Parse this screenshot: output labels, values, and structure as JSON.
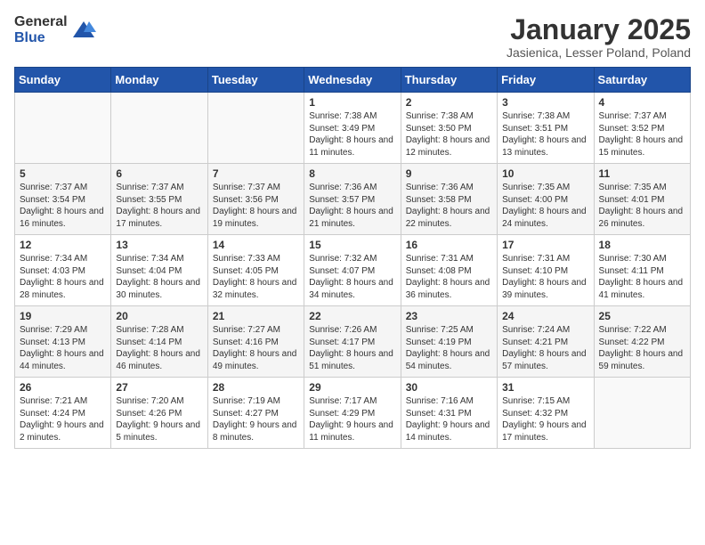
{
  "header": {
    "logo_general": "General",
    "logo_blue": "Blue",
    "month_title": "January 2025",
    "location": "Jasienica, Lesser Poland, Poland"
  },
  "weekdays": [
    "Sunday",
    "Monday",
    "Tuesday",
    "Wednesday",
    "Thursday",
    "Friday",
    "Saturday"
  ],
  "weeks": [
    [
      {
        "day": "",
        "info": ""
      },
      {
        "day": "",
        "info": ""
      },
      {
        "day": "",
        "info": ""
      },
      {
        "day": "1",
        "info": "Sunrise: 7:38 AM\nSunset: 3:49 PM\nDaylight: 8 hours and 11 minutes."
      },
      {
        "day": "2",
        "info": "Sunrise: 7:38 AM\nSunset: 3:50 PM\nDaylight: 8 hours and 12 minutes."
      },
      {
        "day": "3",
        "info": "Sunrise: 7:38 AM\nSunset: 3:51 PM\nDaylight: 8 hours and 13 minutes."
      },
      {
        "day": "4",
        "info": "Sunrise: 7:37 AM\nSunset: 3:52 PM\nDaylight: 8 hours and 15 minutes."
      }
    ],
    [
      {
        "day": "5",
        "info": "Sunrise: 7:37 AM\nSunset: 3:54 PM\nDaylight: 8 hours and 16 minutes."
      },
      {
        "day": "6",
        "info": "Sunrise: 7:37 AM\nSunset: 3:55 PM\nDaylight: 8 hours and 17 minutes."
      },
      {
        "day": "7",
        "info": "Sunrise: 7:37 AM\nSunset: 3:56 PM\nDaylight: 8 hours and 19 minutes."
      },
      {
        "day": "8",
        "info": "Sunrise: 7:36 AM\nSunset: 3:57 PM\nDaylight: 8 hours and 21 minutes."
      },
      {
        "day": "9",
        "info": "Sunrise: 7:36 AM\nSunset: 3:58 PM\nDaylight: 8 hours and 22 minutes."
      },
      {
        "day": "10",
        "info": "Sunrise: 7:35 AM\nSunset: 4:00 PM\nDaylight: 8 hours and 24 minutes."
      },
      {
        "day": "11",
        "info": "Sunrise: 7:35 AM\nSunset: 4:01 PM\nDaylight: 8 hours and 26 minutes."
      }
    ],
    [
      {
        "day": "12",
        "info": "Sunrise: 7:34 AM\nSunset: 4:03 PM\nDaylight: 8 hours and 28 minutes."
      },
      {
        "day": "13",
        "info": "Sunrise: 7:34 AM\nSunset: 4:04 PM\nDaylight: 8 hours and 30 minutes."
      },
      {
        "day": "14",
        "info": "Sunrise: 7:33 AM\nSunset: 4:05 PM\nDaylight: 8 hours and 32 minutes."
      },
      {
        "day": "15",
        "info": "Sunrise: 7:32 AM\nSunset: 4:07 PM\nDaylight: 8 hours and 34 minutes."
      },
      {
        "day": "16",
        "info": "Sunrise: 7:31 AM\nSunset: 4:08 PM\nDaylight: 8 hours and 36 minutes."
      },
      {
        "day": "17",
        "info": "Sunrise: 7:31 AM\nSunset: 4:10 PM\nDaylight: 8 hours and 39 minutes."
      },
      {
        "day": "18",
        "info": "Sunrise: 7:30 AM\nSunset: 4:11 PM\nDaylight: 8 hours and 41 minutes."
      }
    ],
    [
      {
        "day": "19",
        "info": "Sunrise: 7:29 AM\nSunset: 4:13 PM\nDaylight: 8 hours and 44 minutes."
      },
      {
        "day": "20",
        "info": "Sunrise: 7:28 AM\nSunset: 4:14 PM\nDaylight: 8 hours and 46 minutes."
      },
      {
        "day": "21",
        "info": "Sunrise: 7:27 AM\nSunset: 4:16 PM\nDaylight: 8 hours and 49 minutes."
      },
      {
        "day": "22",
        "info": "Sunrise: 7:26 AM\nSunset: 4:17 PM\nDaylight: 8 hours and 51 minutes."
      },
      {
        "day": "23",
        "info": "Sunrise: 7:25 AM\nSunset: 4:19 PM\nDaylight: 8 hours and 54 minutes."
      },
      {
        "day": "24",
        "info": "Sunrise: 7:24 AM\nSunset: 4:21 PM\nDaylight: 8 hours and 57 minutes."
      },
      {
        "day": "25",
        "info": "Sunrise: 7:22 AM\nSunset: 4:22 PM\nDaylight: 8 hours and 59 minutes."
      }
    ],
    [
      {
        "day": "26",
        "info": "Sunrise: 7:21 AM\nSunset: 4:24 PM\nDaylight: 9 hours and 2 minutes."
      },
      {
        "day": "27",
        "info": "Sunrise: 7:20 AM\nSunset: 4:26 PM\nDaylight: 9 hours and 5 minutes."
      },
      {
        "day": "28",
        "info": "Sunrise: 7:19 AM\nSunset: 4:27 PM\nDaylight: 9 hours and 8 minutes."
      },
      {
        "day": "29",
        "info": "Sunrise: 7:17 AM\nSunset: 4:29 PM\nDaylight: 9 hours and 11 minutes."
      },
      {
        "day": "30",
        "info": "Sunrise: 7:16 AM\nSunset: 4:31 PM\nDaylight: 9 hours and 14 minutes."
      },
      {
        "day": "31",
        "info": "Sunrise: 7:15 AM\nSunset: 4:32 PM\nDaylight: 9 hours and 17 minutes."
      },
      {
        "day": "",
        "info": ""
      }
    ]
  ]
}
